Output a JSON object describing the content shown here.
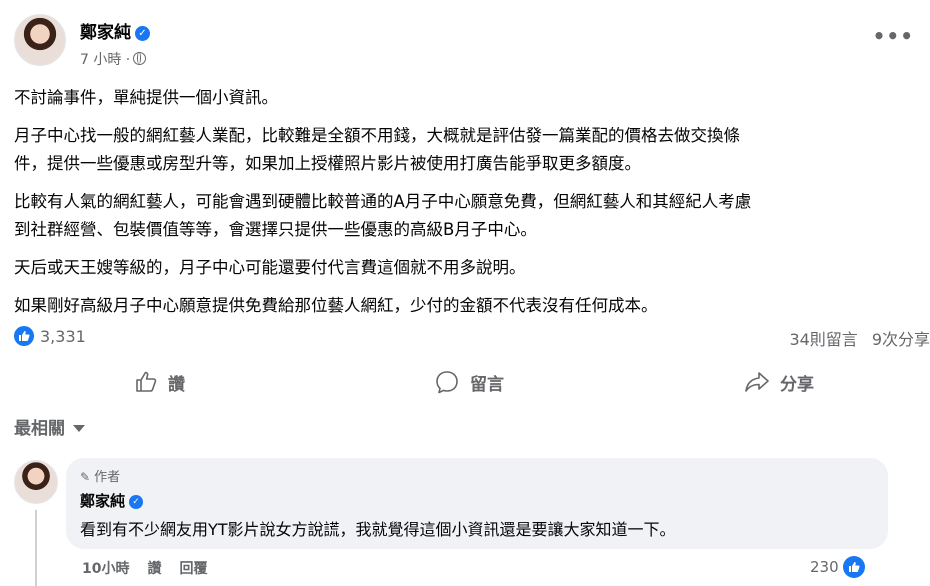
{
  "post": {
    "author": "鄭家純",
    "time": "7 小時 ·",
    "paragraphs": [
      [
        "不討論事件，單純提供一個小資訊。"
      ],
      [
        "月子中心找一般的網紅藝人業配，比較難是全額不用錢，大概就是評估發一篇業配的價格去做交換條",
        "件，提供一些優惠或房型升等，如果加上授權照片影片被使用打廣告能爭取更多額度。"
      ],
      [
        "比較有人氣的網紅藝人，可能會遇到硬體比較普通的A月子中心願意免費，但網紅藝人和其經紀人考慮",
        "到社群經營、包裝價值等等，會選擇只提供一些優惠的高級B月子中心。"
      ],
      [
        "天后或天王嫂等級的，月子中心可能還要付代言費這個就不用多說明。"
      ],
      [
        "如果剛好高級月子中心願意提供免費給那位藝人網紅，少付的金額不代表沒有任何成本。"
      ]
    ]
  },
  "stats": {
    "reactions": "3,331",
    "comments": "34則留言",
    "shares": "9次分享"
  },
  "actions": {
    "like": "讚",
    "comment": "留言",
    "share": "分享"
  },
  "sort": {
    "label": "最相關"
  },
  "comment": {
    "tag": "作者",
    "author": "鄭家純",
    "text": "看到有不少網友用YT影片說女方說謊，我就覺得這個小資訊還是要讓大家知道一下。",
    "time": "10小時",
    "like": "讚",
    "reply": "回覆",
    "likes": "230"
  },
  "colors": {
    "accent": "#1877f2",
    "muted": "#65676b",
    "bubble": "#f0f2f5"
  },
  "icons": [
    "verified-badge-icon",
    "globe-icon",
    "more-dots-icon",
    "like-icon",
    "thumbs-up-icon",
    "comment-icon",
    "share-icon",
    "caret-down-icon",
    "pencil-icon"
  ]
}
